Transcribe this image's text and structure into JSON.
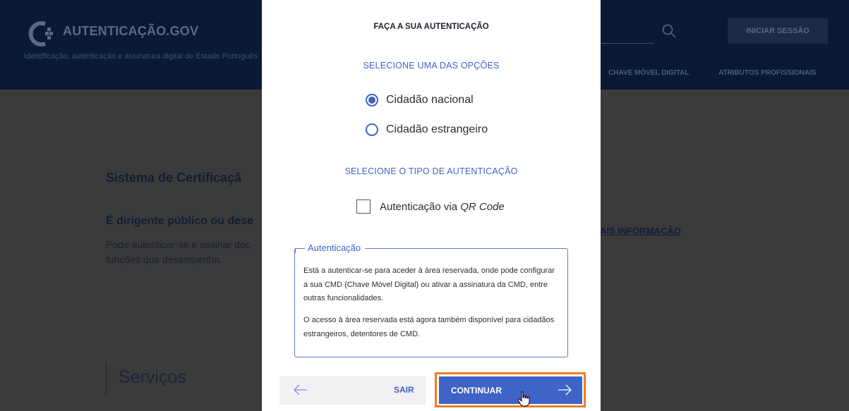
{
  "background": {
    "logo_text": "AUTENTICAÇÃO.GOV",
    "tagline": "Identificação, autenticação e assinatura digital do Estado Português",
    "login_button": "INICIAR SESSÃO",
    "nav": [
      "CHAVE MÓVEL DIGITAL",
      "ATRIBUTOS PROFISSIONAIS"
    ],
    "section_title": "Sistema de Certificaçã",
    "question": "É dirigente público ou dese",
    "text_line1": "Pode autenticar-se e assinar doc",
    "text_line2": "funções que desempenha.",
    "more_link": "AIS INFORMAÇÃO",
    "services": "Serviços"
  },
  "modal": {
    "title": "FAÇA A SUA AUTENTICAÇÃO",
    "options_label": "SELECIONE UMA DAS OPÇÕES",
    "options": [
      {
        "label": "Cidadão nacional",
        "selected": true
      },
      {
        "label": "Cidadão estrangeiro",
        "selected": false
      }
    ],
    "auth_type_label": "SELECIONE O TIPO DE AUTENTICAÇÃO",
    "qr_prefix": "Autenticação via ",
    "qr_emph": "QR Code",
    "qr_checked": false,
    "info": {
      "legend": "Autenticação",
      "p1": "Está a autenticar-se para aceder à área reservada, onde pode configurar a sua CMD (Chave Móvel Digital) ou ativar a assinatura da CMD, entre outras funcionalidades.",
      "p2": "O acesso à área reservada está agora também disponível para cidadãos estrangeiros, detentores de CMD."
    },
    "exit_button": "SAIR",
    "continue_button": "CONTINUAR"
  },
  "colors": {
    "accent": "#3f63c7",
    "highlight": "#f07c24",
    "header_bg": "#0a1a33",
    "overlay_bg": "#3b3b3b"
  }
}
